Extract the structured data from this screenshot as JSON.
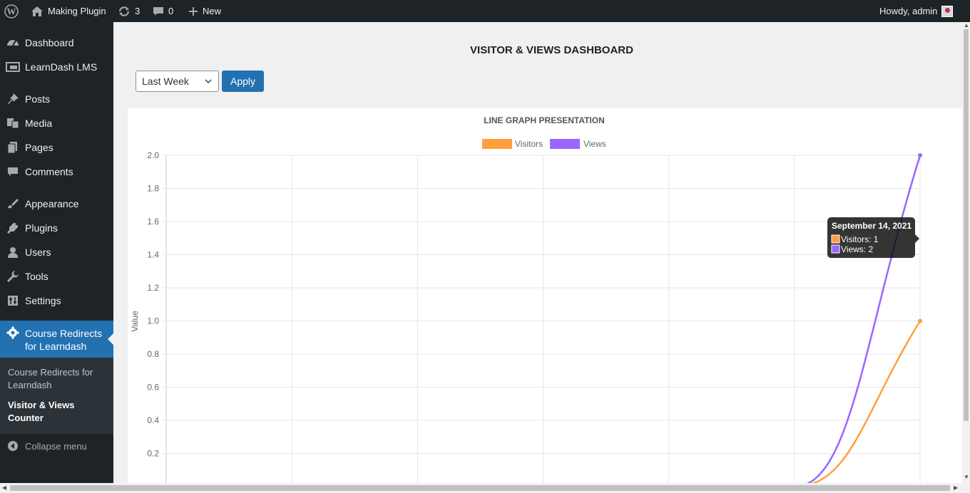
{
  "adminbar": {
    "site_name": "Making Plugin",
    "updates_count": "3",
    "comments_count": "0",
    "new_label": "New",
    "greeting": "Howdy, admin"
  },
  "sidebar": {
    "items": [
      {
        "label": "Dashboard",
        "icon": "dashboard-icon"
      },
      {
        "label": "LearnDash LMS",
        "icon": "learndash-icon"
      },
      {
        "label": "Posts",
        "icon": "pin-icon"
      },
      {
        "label": "Media",
        "icon": "media-icon"
      },
      {
        "label": "Pages",
        "icon": "pages-icon"
      },
      {
        "label": "Comments",
        "icon": "comments-icon"
      },
      {
        "label": "Appearance",
        "icon": "brush-icon"
      },
      {
        "label": "Plugins",
        "icon": "plugin-icon"
      },
      {
        "label": "Users",
        "icon": "users-icon"
      },
      {
        "label": "Tools",
        "icon": "wrench-icon"
      },
      {
        "label": "Settings",
        "icon": "settings-icon"
      }
    ],
    "current": {
      "label": "Course Redirects for Learndash",
      "icon": "gear-icon"
    },
    "submenu": [
      "Course Redirects for Learndash",
      "Visitor & Views Counter"
    ],
    "collapse_label": "Collapse menu"
  },
  "main": {
    "title": "VISITOR & VIEWS DASHBOARD",
    "range_selected": "Last Week",
    "apply_label": "Apply"
  },
  "colors": {
    "visitors": "#ff9f40",
    "views": "#9966ff",
    "accent": "#2271b1",
    "adminbar": "#1d2327"
  },
  "chart_data": {
    "type": "line",
    "title": "LINE GRAPH PRESENTATION",
    "ylabel": "Value",
    "ylim": [
      0,
      2.0
    ],
    "yticks": [
      "2.0",
      "1.8",
      "1.6",
      "1.4",
      "1.2",
      "1.0",
      "0.8",
      "0.6",
      "0.4",
      "0.2"
    ],
    "legend_position": "top",
    "grid": true,
    "series": [
      {
        "name": "Visitors",
        "values": [
          0,
          0,
          0,
          0,
          0,
          0,
          1
        ]
      },
      {
        "name": "Views",
        "values": [
          0,
          0,
          0,
          0,
          0,
          0,
          2
        ]
      }
    ],
    "tooltip": {
      "title": "September 14, 2021",
      "lines": [
        "Visitors: 1",
        "Views: 2"
      ]
    }
  }
}
